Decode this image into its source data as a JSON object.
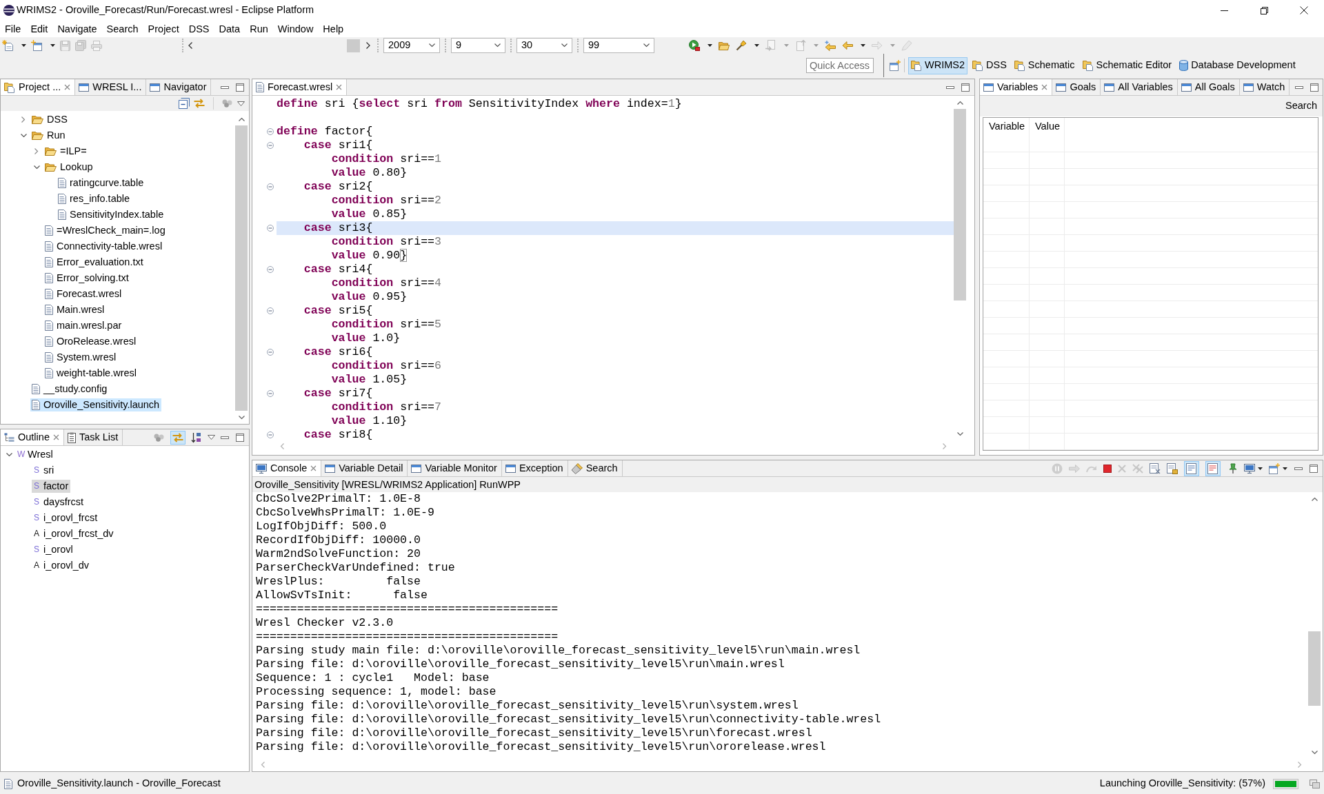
{
  "window": {
    "title": "WRIMS2 - Oroville_Forecast/Run/Forecast.wresl - Eclipse Platform"
  },
  "menu": [
    "File",
    "Edit",
    "Navigate",
    "Search",
    "Project",
    "DSS",
    "Data",
    "Run",
    "Window",
    "Help"
  ],
  "toolbar": {
    "file_tools": [
      {
        "disabled": false
      },
      {
        "disabled": false
      },
      {
        "disabled": true
      },
      {
        "disabled": true
      },
      {
        "disabled": true
      }
    ],
    "combos": [
      {
        "value": "2009"
      },
      {
        "value": "9"
      },
      {
        "value": "30"
      },
      {
        "value": "99"
      }
    ],
    "run_tools": [
      {
        "disabled": false
      },
      {
        "disabled": false
      },
      {
        "disabled": false
      },
      {
        "disabled": true
      },
      {
        "disabled": true
      },
      {
        "disabled": false
      },
      {
        "disabled": false
      },
      {
        "disabled": true
      },
      {
        "disabled": true
      }
    ]
  },
  "quick_access": {
    "placeholder": "Quick Access"
  },
  "perspectives": [
    {
      "label": "WRIMS2",
      "kind": "folder",
      "selected": true
    },
    {
      "label": "DSS",
      "kind": "folder",
      "selected": false
    },
    {
      "label": "Schematic",
      "kind": "folder",
      "selected": false
    },
    {
      "label": "Schematic Editor",
      "kind": "folder",
      "selected": false
    },
    {
      "label": "Database Development",
      "kind": "database",
      "selected": false
    }
  ],
  "project_panel": {
    "tabs": [
      {
        "label": "Project ...",
        "selected": true
      },
      {
        "label": "WRESL I...",
        "selected": false
      },
      {
        "label": "Navigator",
        "selected": false
      }
    ],
    "tree": [
      {
        "label": "DSS",
        "kind": "folder",
        "expanded": false,
        "selected": false
      },
      {
        "label": "Run",
        "kind": "folder",
        "expanded": true,
        "selected": false,
        "children": [
          {
            "label": "=ILP=",
            "kind": "folder",
            "expanded": false,
            "selected": false
          },
          {
            "label": "Lookup",
            "kind": "folder",
            "expanded": true,
            "selected": false,
            "children": [
              {
                "label": "ratingcurve.table",
                "kind": "file",
                "selected": false
              },
              {
                "label": "res_info.table",
                "kind": "file",
                "selected": false
              },
              {
                "label": "SensitivityIndex.table",
                "kind": "file",
                "selected": false
              }
            ]
          },
          {
            "label": "=WreslCheck_main=.log",
            "kind": "file",
            "selected": false
          },
          {
            "label": "Connectivity-table.wresl",
            "kind": "file",
            "selected": false
          },
          {
            "label": "Error_evaluation.txt",
            "kind": "file",
            "selected": false
          },
          {
            "label": "Error_solving.txt",
            "kind": "file",
            "selected": false
          },
          {
            "label": "Forecast.wresl",
            "kind": "file",
            "selected": false
          },
          {
            "label": "Main.wresl",
            "kind": "file",
            "selected": false
          },
          {
            "label": "main.wresl.par",
            "kind": "file",
            "selected": false
          },
          {
            "label": "OroRelease.wresl",
            "kind": "file",
            "selected": false
          },
          {
            "label": "System.wresl",
            "kind": "file",
            "selected": false
          },
          {
            "label": "weight-table.wresl",
            "kind": "file",
            "selected": false
          }
        ]
      },
      {
        "label": "__study.config",
        "kind": "file",
        "selected": false
      },
      {
        "label": "Oroville_Sensitivity.launch",
        "kind": "file",
        "selected": true
      }
    ]
  },
  "outline_panel": {
    "tabs": [
      {
        "label": "Outline",
        "selected": true
      },
      {
        "label": "Task List",
        "selected": false
      }
    ],
    "toolbar": [
      {
        "on": false
      },
      {
        "on": true
      },
      {
        "on": false
      }
    ],
    "tree": [
      {
        "glyph": "W",
        "label": "Wresl",
        "kind": "wresl",
        "expanded": true,
        "selected": false,
        "children": [
          {
            "glyph": "S",
            "label": "sri",
            "kind": "svar",
            "selected": false
          },
          {
            "glyph": "S",
            "label": "factor",
            "kind": "svar",
            "selected": true
          },
          {
            "glyph": "S",
            "label": "daysfrcst",
            "kind": "svar",
            "selected": false
          },
          {
            "glyph": "S",
            "label": "i_orovl_frcst",
            "kind": "svar",
            "selected": false
          },
          {
            "glyph": "A",
            "label": "i_orovl_frcst_dv",
            "kind": "alias",
            "selected": false
          },
          {
            "glyph": "S",
            "label": "i_orovl",
            "kind": "svar",
            "selected": false
          },
          {
            "glyph": "A",
            "label": "i_orovl_dv",
            "kind": "alias",
            "selected": false
          }
        ]
      }
    ]
  },
  "editor": {
    "tabs": [
      {
        "label": "Forecast.wresl",
        "selected": true
      }
    ],
    "lines": [
      {
        "fold": false,
        "current": false,
        "tokens": [
          {
            "kind": "keyword",
            "text": "define"
          },
          {
            "kind": "plain",
            "text": " sri {"
          },
          {
            "kind": "keyword",
            "text": "select"
          },
          {
            "kind": "plain",
            "text": " sri "
          },
          {
            "kind": "keyword",
            "text": "from"
          },
          {
            "kind": "plain",
            "text": " SensitivityIndex "
          },
          {
            "kind": "keyword",
            "text": "where"
          },
          {
            "kind": "plain",
            "text": " index="
          },
          {
            "kind": "number",
            "text": "1"
          },
          {
            "kind": "plain",
            "text": "}"
          }
        ]
      },
      {
        "fold": false,
        "current": false
      },
      {
        "fold": true,
        "current": false,
        "tokens": [
          {
            "kind": "keyword",
            "text": "define"
          },
          {
            "kind": "plain",
            "text": " factor{"
          }
        ]
      },
      {
        "fold": true,
        "current": false,
        "tokens": [
          {
            "kind": "keyword",
            "text": "    case"
          },
          {
            "kind": "plain",
            "text": " sri1{"
          }
        ]
      },
      {
        "fold": false,
        "current": false,
        "tokens": [
          {
            "kind": "keyword",
            "text": "        condition"
          },
          {
            "kind": "plain",
            "text": " sri=="
          },
          {
            "kind": "number",
            "text": "1"
          }
        ]
      },
      {
        "fold": false,
        "current": false,
        "tokens": [
          {
            "kind": "keyword",
            "text": "        value"
          },
          {
            "kind": "plain",
            "text": " 0.80}"
          }
        ]
      },
      {
        "fold": true,
        "current": false,
        "tokens": [
          {
            "kind": "keyword",
            "text": "    case"
          },
          {
            "kind": "plain",
            "text": " sri2{"
          }
        ]
      },
      {
        "fold": false,
        "current": false,
        "tokens": [
          {
            "kind": "keyword",
            "text": "        condition"
          },
          {
            "kind": "plain",
            "text": " sri=="
          },
          {
            "kind": "number",
            "text": "2"
          }
        ]
      },
      {
        "fold": false,
        "current": false,
        "tokens": [
          {
            "kind": "keyword",
            "text": "        value"
          },
          {
            "kind": "plain",
            "text": " 0.85}"
          }
        ]
      },
      {
        "fold": true,
        "current": true,
        "tokens": [
          {
            "kind": "keyword",
            "text": "    case"
          },
          {
            "kind": "plain",
            "text": " sri3{"
          }
        ]
      },
      {
        "fold": false,
        "current": false,
        "tokens": [
          {
            "kind": "keyword",
            "text": "        condition"
          },
          {
            "kind": "plain",
            "text": " sri=="
          },
          {
            "kind": "number",
            "text": "3"
          }
        ]
      },
      {
        "fold": false,
        "current": false,
        "tokens": [
          {
            "kind": "keyword",
            "text": "        value"
          },
          {
            "kind": "plain",
            "text": " 0.90"
          },
          {
            "kind": "bracket_match",
            "text": "}"
          }
        ]
      },
      {
        "fold": true,
        "current": false,
        "tokens": [
          {
            "kind": "keyword",
            "text": "    case"
          },
          {
            "kind": "plain",
            "text": " sri4{"
          }
        ]
      },
      {
        "fold": false,
        "current": false,
        "tokens": [
          {
            "kind": "keyword",
            "text": "        condition"
          },
          {
            "kind": "plain",
            "text": " sri=="
          },
          {
            "kind": "number",
            "text": "4"
          }
        ]
      },
      {
        "fold": false,
        "current": false,
        "tokens": [
          {
            "kind": "keyword",
            "text": "        value"
          },
          {
            "kind": "plain",
            "text": " 0.95}"
          }
        ]
      },
      {
        "fold": true,
        "current": false,
        "tokens": [
          {
            "kind": "keyword",
            "text": "    case"
          },
          {
            "kind": "plain",
            "text": " sri5{"
          }
        ]
      },
      {
        "fold": false,
        "current": false,
        "tokens": [
          {
            "kind": "keyword",
            "text": "        condition"
          },
          {
            "kind": "plain",
            "text": " sri=="
          },
          {
            "kind": "number",
            "text": "5"
          }
        ]
      },
      {
        "fold": false,
        "current": false,
        "tokens": [
          {
            "kind": "keyword",
            "text": "        value"
          },
          {
            "kind": "plain",
            "text": " 1.0}"
          }
        ]
      },
      {
        "fold": true,
        "current": false,
        "tokens": [
          {
            "kind": "keyword",
            "text": "    case"
          },
          {
            "kind": "plain",
            "text": " sri6{"
          }
        ]
      },
      {
        "fold": false,
        "current": false,
        "tokens": [
          {
            "kind": "keyword",
            "text": "        condition"
          },
          {
            "kind": "plain",
            "text": " sri=="
          },
          {
            "kind": "number",
            "text": "6"
          }
        ]
      },
      {
        "fold": false,
        "current": false,
        "tokens": [
          {
            "kind": "keyword",
            "text": "        value"
          },
          {
            "kind": "plain",
            "text": " 1.05}"
          }
        ]
      },
      {
        "fold": true,
        "current": false,
        "tokens": [
          {
            "kind": "keyword",
            "text": "    case"
          },
          {
            "kind": "plain",
            "text": " sri7{"
          }
        ]
      },
      {
        "fold": false,
        "current": false,
        "tokens": [
          {
            "kind": "keyword",
            "text": "        condition"
          },
          {
            "kind": "plain",
            "text": " sri=="
          },
          {
            "kind": "number",
            "text": "7"
          }
        ]
      },
      {
        "fold": false,
        "current": false,
        "tokens": [
          {
            "kind": "keyword",
            "text": "        value"
          },
          {
            "kind": "plain",
            "text": " 1.10}"
          }
        ]
      },
      {
        "fold": true,
        "current": false,
        "tokens": [
          {
            "kind": "keyword",
            "text": "    case"
          },
          {
            "kind": "plain",
            "text": " sri8{"
          }
        ]
      }
    ]
  },
  "variables_panel": {
    "tabs": [
      {
        "label": "Variables",
        "selected": true
      },
      {
        "label": "Goals",
        "selected": false
      },
      {
        "label": "All Variables",
        "selected": false
      },
      {
        "label": "All Goals",
        "selected": false
      },
      {
        "label": "Watch",
        "selected": false
      }
    ],
    "search_label": "Search",
    "columns": [
      "Variable",
      "Value"
    ]
  },
  "console": {
    "tabs": [
      {
        "label": "Console",
        "selected": true
      },
      {
        "label": "Variable Detail",
        "selected": false
      },
      {
        "label": "Variable Monitor",
        "selected": false
      },
      {
        "label": "Exception",
        "selected": false
      },
      {
        "label": "Search",
        "selected": false
      }
    ],
    "toolbar": [
      {
        "disabled": true,
        "on": false
      },
      {
        "disabled": true,
        "on": false
      },
      {
        "disabled": true,
        "on": false
      },
      {
        "disabled": false,
        "on": false
      },
      {
        "disabled": true,
        "on": false
      },
      {
        "disabled": true,
        "on": false
      },
      {
        "disabled": false,
        "on": false
      },
      {
        "disabled": false,
        "on": false
      },
      {
        "disabled": false,
        "on": true
      },
      {
        "disabled": false,
        "on": true
      },
      {
        "disabled": false,
        "on": false
      },
      {
        "disabled": false,
        "on": false
      },
      {
        "disabled": false,
        "on": false
      }
    ],
    "process": "Oroville_Sensitivity [WRESL/WRIMS2 Application] RunWPP",
    "lines": [
      "CbcSolve2PrimalT: 1.0E-8",
      "CbcSolveWhsPrimalT: 1.0E-9",
      "LogIfObjDiff: 500.0",
      "RecordIfObjDiff: 10000.0",
      "Warm2ndSolveFunction: 20",
      "ParserCheckVarUndefined: true",
      "WreslPlus:         false",
      "AllowSvTsInit:      false",
      "============================================",
      "Wresl Checker v2.3.0",
      "============================================",
      "Parsing study main file: d:\\oroville\\oroville_forecast_sensitivity_level5\\run\\main.wresl",
      "Parsing file: d:\\oroville\\oroville_forecast_sensitivity_level5\\run\\main.wresl",
      "Sequence: 1 : cycle1   Model: base",
      "Processing sequence: 1, model: base",
      "Parsing file: d:\\oroville\\oroville_forecast_sensitivity_level5\\run\\system.wresl",
      "Parsing file: d:\\oroville\\oroville_forecast_sensitivity_level5\\run\\connectivity-table.wresl",
      "Parsing file: d:\\oroville\\oroville_forecast_sensitivity_level5\\run\\forecast.wresl",
      "Parsing file: d:\\oroville\\oroville_forecast_sensitivity_level5\\run\\ororelease.wresl"
    ]
  },
  "status_bar": {
    "left_text": "Oroville_Sensitivity.launch - Oroville_Forecast",
    "progress_text": "Launching Oroville_Sensitivity: (57%)",
    "progress": {
      "level": 1
    }
  }
}
